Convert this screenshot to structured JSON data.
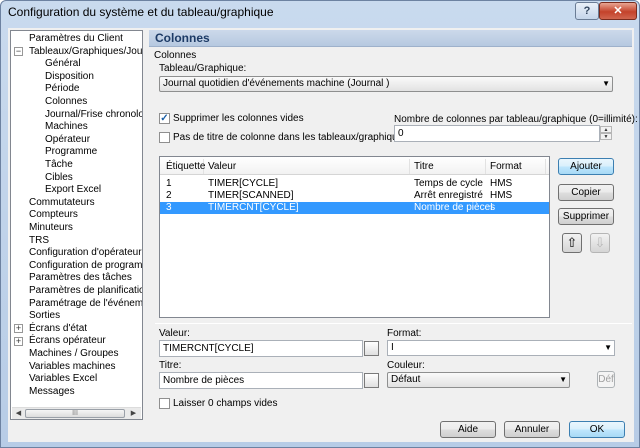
{
  "window": {
    "title": "Configuration du système et du tableau/graphique",
    "help_label": "?",
    "close_label": "✕"
  },
  "tree": {
    "items": [
      {
        "label": "Paramètres du Client",
        "level": 0,
        "expander": ""
      },
      {
        "label": "Tableaux/Graphiques/Journaux",
        "level": 0,
        "expander": "−"
      },
      {
        "label": "Général",
        "level": 1,
        "expander": ""
      },
      {
        "label": "Disposition",
        "level": 1,
        "expander": ""
      },
      {
        "label": "Période",
        "level": 1,
        "expander": ""
      },
      {
        "label": "Colonnes",
        "level": 1,
        "expander": ""
      },
      {
        "label": "Journal/Frise chronologique",
        "level": 1,
        "expander": ""
      },
      {
        "label": "Machines",
        "level": 1,
        "expander": ""
      },
      {
        "label": "Opérateur",
        "level": 1,
        "expander": ""
      },
      {
        "label": "Programme",
        "level": 1,
        "expander": ""
      },
      {
        "label": "Tâche",
        "level": 1,
        "expander": ""
      },
      {
        "label": "Cibles",
        "level": 1,
        "expander": ""
      },
      {
        "label": "Export Excel",
        "level": 1,
        "expander": ""
      },
      {
        "label": "Commutateurs",
        "level": 0,
        "expander": ""
      },
      {
        "label": "Compteurs",
        "level": 0,
        "expander": ""
      },
      {
        "label": "Minuteurs",
        "level": 0,
        "expander": ""
      },
      {
        "label": "TRS",
        "level": 0,
        "expander": ""
      },
      {
        "label": "Configuration d'opérateur",
        "level": 0,
        "expander": ""
      },
      {
        "label": "Configuration de programme",
        "level": 0,
        "expander": ""
      },
      {
        "label": "Paramètres des tâches",
        "level": 0,
        "expander": ""
      },
      {
        "label": "Paramètres de planification",
        "level": 0,
        "expander": ""
      },
      {
        "label": "Paramétrage de l'événement",
        "level": 0,
        "expander": ""
      },
      {
        "label": "Sorties",
        "level": 0,
        "expander": ""
      },
      {
        "label": "Écrans d'état",
        "level": 0,
        "expander": "+"
      },
      {
        "label": "Écrans opérateur",
        "level": 0,
        "expander": "+"
      },
      {
        "label": "Machines / Groupes",
        "level": 0,
        "expander": ""
      },
      {
        "label": "Variables machines",
        "level": 0,
        "expander": ""
      },
      {
        "label": "Variables Excel",
        "level": 0,
        "expander": ""
      },
      {
        "label": "Messages",
        "level": 0,
        "expander": ""
      }
    ],
    "scroll_left": "◀",
    "scroll_right": "▶",
    "scroll_thumb": "III"
  },
  "section": {
    "title": "Colonnes",
    "group_label": "Colonnes"
  },
  "chart_select": {
    "label": "Tableau/Graphique:",
    "value": "Journal quotidien d'événements machine  (Journal )"
  },
  "options": {
    "suppress_empty_label": "Supprimer les colonnes vides",
    "suppress_empty_checked": true,
    "no_title_label": "Pas de titre de colonne dans les tableaux/graphiques",
    "no_title_checked": false,
    "count_label": "Nombre de colonnes par tableau/graphique (0=illimité):",
    "count_value": "0"
  },
  "table": {
    "headers": {
      "tag": "Étiquette",
      "value": "Valeur",
      "title": "Titre",
      "format": "Format"
    },
    "rows": [
      {
        "tag": "1",
        "value": "TIMER[CYCLE]",
        "title": "Temps de cycle",
        "format": "HMS",
        "selected": false
      },
      {
        "tag": "2",
        "value": "TIMER[SCANNED]",
        "title": "Arrêt enregistré",
        "format": "HMS",
        "selected": false
      },
      {
        "tag": "3",
        "value": "TIMERCNT[CYCLE]",
        "title": "Nombre de pièces",
        "format": "I",
        "selected": true
      }
    ]
  },
  "side_buttons": {
    "add": "Ajouter",
    "copy": "Copier",
    "delete": "Supprimer",
    "up_glyph": "⇧",
    "down_glyph": "⇩"
  },
  "edit": {
    "value_label": "Valeur:",
    "value": "TIMERCNT[CYCLE]",
    "format_label": "Format:",
    "format_value": "I",
    "title_label": "Titre:",
    "title_value": "Nombre de pièces",
    "color_label": "Couleur:",
    "color_value": "Défaut",
    "def_button": "Déf",
    "leave_zero_label": "Laisser 0 champs vides",
    "leave_zero_checked": false
  },
  "footer": {
    "help": "Aide",
    "cancel": "Annuler",
    "ok": "OK"
  },
  "colors": {
    "selection": "#3399ff",
    "header_text": "#1d3b66"
  }
}
